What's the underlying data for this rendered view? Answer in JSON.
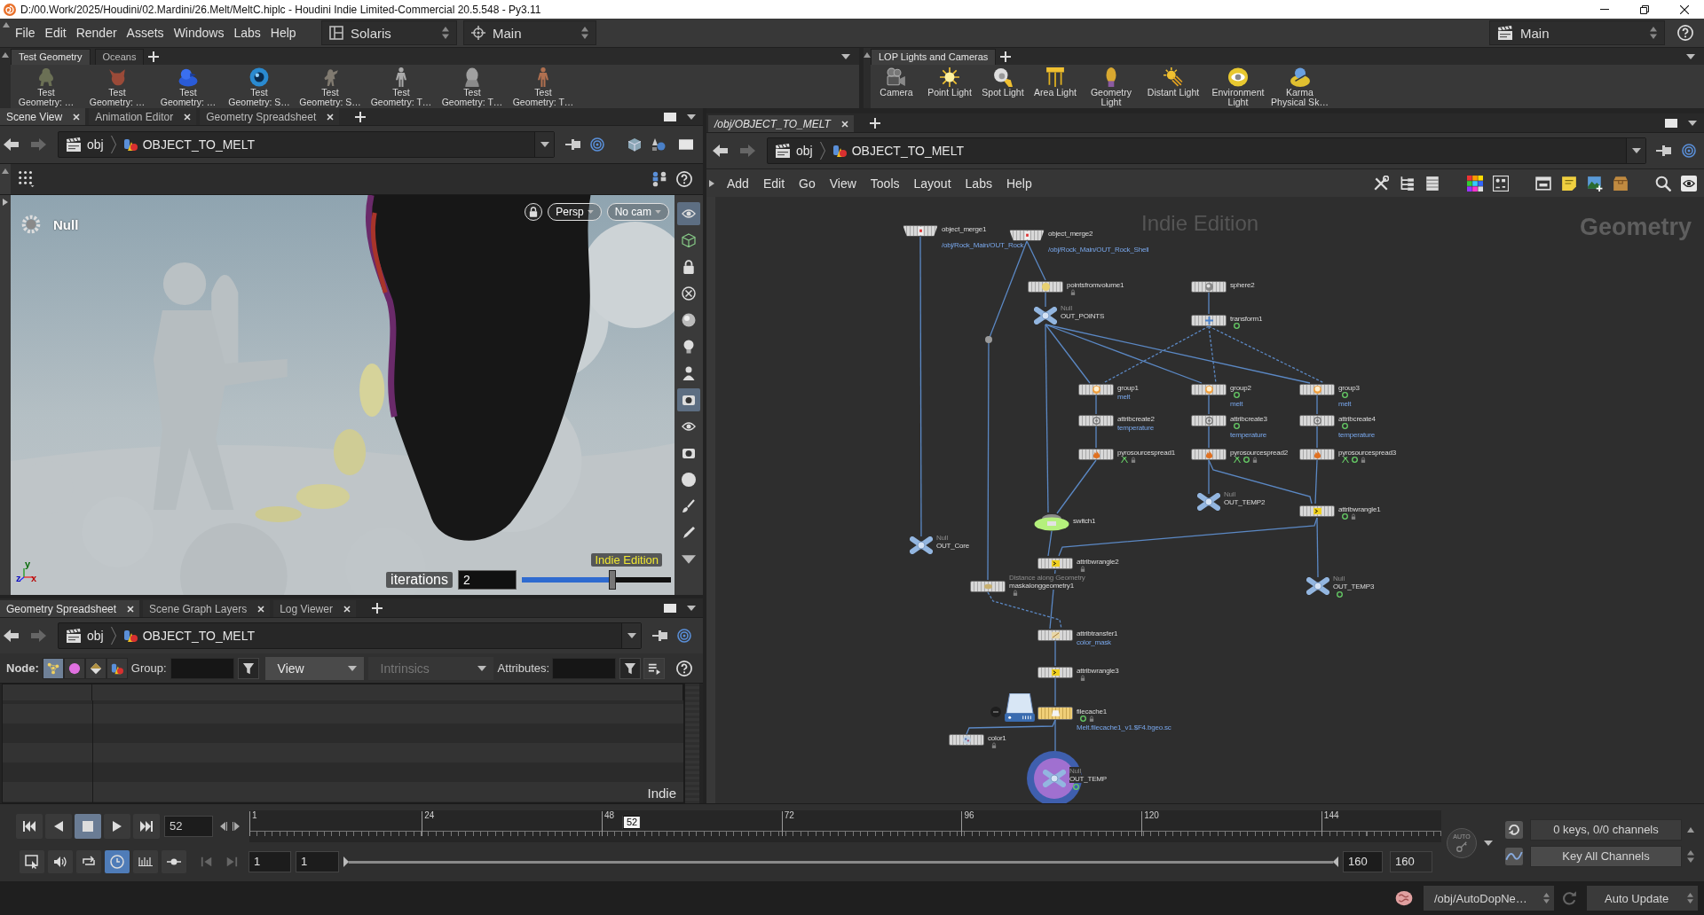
{
  "window": {
    "title": "D:/00.Work/2025/Houdini/02.Mardini/26.Melt/MeltC.hiplc - Houdini Indie Limited-Commercial 20.5.548 - Py3.11"
  },
  "menu_bar": {
    "menus": [
      "File",
      "Edit",
      "Render",
      "Assets",
      "Windows",
      "Labs",
      "Help"
    ],
    "desktop": "Solaris",
    "context": "Main",
    "right_context": "Main"
  },
  "shelves": [
    {
      "tabs": [
        {
          "label": "Test Geometry",
          "selected": true
        },
        {
          "label": "Oceans",
          "selected": false
        }
      ],
      "tools": [
        "Test Geometry: …",
        "Test Geometry: …",
        "Test Geometry: …",
        "Test Geometry: S…",
        "Test Geometry: S…",
        "Test Geometry: T…",
        "Test Geometry: T…",
        "Test Geometry: T…"
      ]
    },
    {
      "tabs": [
        {
          "label": "LOP Lights and Cameras",
          "selected": true
        }
      ],
      "tools": [
        "Camera",
        "Point Light",
        "Spot Light",
        "Area Light",
        "Geometry Light",
        "Distant Light",
        "Environment Light",
        "Karma Physical Sk…"
      ]
    }
  ],
  "scene_view": {
    "tabs": [
      {
        "label": "Scene View",
        "selected": true
      },
      {
        "label": "Animation Editor",
        "selected": false
      },
      {
        "label": "Geometry Spreadsheet",
        "selected": false
      }
    ],
    "path": [
      "obj",
      "OBJECT_TO_MELT"
    ],
    "node_label": "Null",
    "view_menus": [
      "Persp",
      "No cam"
    ],
    "axes": [
      "y",
      "z",
      "x"
    ],
    "watermark": "Indie Edition",
    "operator": {
      "label": "iterations",
      "value": "2",
      "level": 0.61
    },
    "tools": [
      {
        "selected": true
      },
      {
        "selected": false
      },
      {
        "selected": false
      },
      {
        "selected": false
      },
      {
        "selected": false
      },
      {
        "selected": false
      },
      {
        "selected": false
      },
      {
        "selected": true
      },
      {
        "selected": false
      },
      {
        "selected": false
      },
      {
        "selected": false
      },
      {
        "selected": false
      },
      {
        "selected": false
      },
      {
        "selected": false
      }
    ]
  },
  "spreadsheet": {
    "tabs": [
      {
        "label": "Geometry Spreadsheet",
        "selected": true
      },
      {
        "label": "Scene Graph Layers",
        "selected": false
      },
      {
        "label": "Log Viewer",
        "selected": false
      }
    ],
    "path": [
      "obj",
      "OBJECT_TO_MELT"
    ],
    "node_label": "Node:",
    "classes": [
      {
        "selected": true
      },
      {
        "selected": false
      },
      {
        "selected": false
      },
      {
        "selected": false
      }
    ],
    "group_label": "Group:",
    "dropdowns": [
      {
        "label": "View",
        "disabled": false
      },
      {
        "label": "Intrinsics",
        "disabled": true
      }
    ],
    "attributes_label": "Attributes:",
    "watermark": "Indie"
  },
  "network": {
    "tabs": [
      {
        "label": "/obj/OBJECT_TO_MELT",
        "selected": true
      }
    ],
    "path": [
      "obj",
      "OBJECT_TO_MELT"
    ],
    "menus": [
      "Add",
      "Edit",
      "Go",
      "View",
      "Tools",
      "Layout",
      "Labs",
      "Help"
    ],
    "watermark": "Indie Edition",
    "context": "Geometry",
    "nodes": [
      {
        "name": "object_merge1",
        "kind": "merge",
        "parameter": "/obj/Rock_Main/OUT_Rock",
        "time_dependent": false,
        "locked": false,
        "linked": false,
        "display": false
      },
      {
        "name": "object_merge2",
        "kind": "merge",
        "parameter": "/obj/Rock_Main/OUT_Rock_Shell",
        "time_dependent": false,
        "locked": false,
        "linked": false,
        "display": false
      },
      {
        "name": "pointsfromvolume1",
        "kind": "sop",
        "time_dependent": false,
        "locked": true,
        "linked": false,
        "display": false
      },
      {
        "name": "OUT_POINTS",
        "kind": "null",
        "type_label": "Null",
        "time_dependent": false,
        "locked": false,
        "linked": false,
        "display": false
      },
      {
        "name": "sphere2",
        "kind": "sop",
        "time_dependent": false,
        "locked": false,
        "linked": false,
        "display": false
      },
      {
        "name": "transform1",
        "kind": "sop",
        "time_dependent": true,
        "locked": false,
        "linked": false,
        "display": false
      },
      {
        "name": "group1",
        "kind": "sop",
        "parameter": "melt",
        "time_dependent": false,
        "locked": false,
        "linked": false,
        "display": false
      },
      {
        "name": "group2",
        "kind": "sop",
        "parameter": "melt",
        "time_dependent": true,
        "locked": false,
        "linked": false,
        "display": false
      },
      {
        "name": "group3",
        "kind": "sop",
        "parameter": "melt",
        "time_dependent": true,
        "locked": false,
        "linked": false,
        "display": false
      },
      {
        "name": "attribcreate2",
        "kind": "sop",
        "parameter": "temperature",
        "time_dependent": false,
        "locked": false,
        "linked": false,
        "display": false
      },
      {
        "name": "attribcreate3",
        "kind": "sop",
        "parameter": "temperature",
        "time_dependent": true,
        "locked": false,
        "linked": false,
        "display": false
      },
      {
        "name": "attribcreate4",
        "kind": "sop",
        "parameter": "temperature",
        "time_dependent": true,
        "locked": false,
        "linked": false,
        "display": false
      },
      {
        "name": "pyrosourcespread1",
        "kind": "sop",
        "time_dependent": false,
        "locked": true,
        "linked": true,
        "display": false
      },
      {
        "name": "pyrosourcespread2",
        "kind": "sop",
        "time_dependent": true,
        "locked": true,
        "linked": true,
        "display": false
      },
      {
        "name": "pyrosourcespread3",
        "kind": "sop",
        "time_dependent": true,
        "locked": true,
        "linked": true,
        "display": false
      },
      {
        "name": "OUT_TEMP2",
        "kind": "null",
        "type_label": "Null",
        "time_dependent": false,
        "locked": false,
        "linked": false,
        "display": false
      },
      {
        "name": "attribwrangle1",
        "kind": "sop",
        "time_dependent": true,
        "locked": true,
        "linked": false,
        "display": false
      },
      {
        "name": "switch1",
        "kind": "switch",
        "time_dependent": false,
        "locked": false,
        "linked": false,
        "display": false
      },
      {
        "name": "OUT_Core",
        "kind": "null",
        "type_label": "Null",
        "time_dependent": false,
        "locked": false,
        "linked": false,
        "display": false
      },
      {
        "name": "attribwrangle2",
        "kind": "sop",
        "time_dependent": false,
        "locked": true,
        "linked": false,
        "display": false
      },
      {
        "name": "maskalonggeometry1",
        "kind": "sop",
        "comment": "Distance along Geometry",
        "time_dependent": false,
        "locked": true,
        "linked": false,
        "display": false
      },
      {
        "name": "OUT_TEMP3",
        "kind": "null",
        "type_label": "Null",
        "time_dependent": true,
        "locked": false,
        "linked": false,
        "display": false
      },
      {
        "name": "attribtransfer1",
        "kind": "sop",
        "parameter": "color_mask",
        "time_dependent": false,
        "locked": false,
        "linked": false,
        "display": false
      },
      {
        "name": "attribwrangle3",
        "kind": "sop",
        "time_dependent": false,
        "locked": true,
        "linked": false,
        "display": false
      },
      {
        "name": "filecache1",
        "kind": "cache",
        "parameter": "Melt.filecache1_v1.$F4.bgeo.sc",
        "time_dependent": true,
        "locked": true,
        "linked": false,
        "display": false
      },
      {
        "name": "color1",
        "kind": "sop",
        "time_dependent": false,
        "locked": true,
        "linked": false,
        "display": false
      },
      {
        "name": "OUT_TEMP",
        "kind": "null",
        "type_label": "Null",
        "time_dependent": true,
        "locked": false,
        "linked": false,
        "display": true
      }
    ]
  },
  "playbar": {
    "transport": [
      {
        "selected": false
      },
      {
        "selected": false
      },
      {
        "selected": true
      },
      {
        "selected": false
      },
      {
        "selected": false
      }
    ],
    "frame": "52",
    "ticks": [
      "1",
      "24",
      "48",
      "72",
      "96",
      "120",
      "144"
    ],
    "playhead": {
      "label": "52",
      "level": 0.321
    },
    "auto_key": "AUTO",
    "keys": "0 keys, 0/0 channels",
    "key_button": "Key All Channels",
    "options": [
      {
        "selected": false
      },
      {
        "selected": false
      },
      {
        "selected": false
      },
      {
        "selected": true
      },
      {
        "selected": false
      },
      {
        "selected": false
      }
    ],
    "start": "1",
    "range_start": "1",
    "range_slider": {
      "level": 1
    },
    "range_end": "160",
    "end": "160"
  },
  "status_bar": {
    "path": "/obj/AutoDopNe…",
    "update": "Auto Update"
  }
}
